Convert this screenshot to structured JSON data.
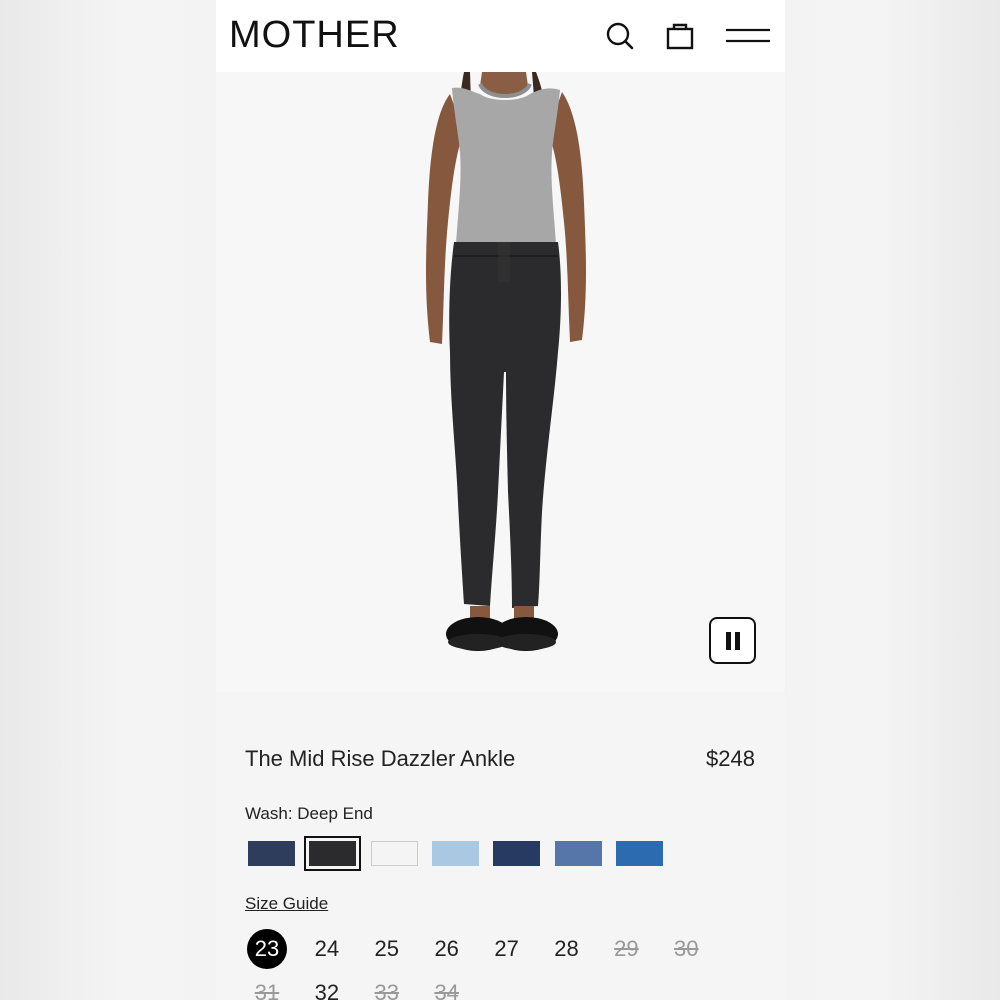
{
  "header": {
    "logo": "MOTHER",
    "icons": [
      "search-icon",
      "shopping-bag-icon",
      "hamburger-menu-icon"
    ]
  },
  "hero": {
    "media_control_icon": "pause-icon"
  },
  "product": {
    "title": "The Mid Rise Dazzler Ankle",
    "price": "$248",
    "wash_label": "Wash: Deep End",
    "swatches": [
      {
        "color": "#2f3d5c",
        "selected": false
      },
      {
        "color": "#2b2b2d",
        "selected": true
      },
      {
        "color": "#f4f4f4",
        "selected": false
      },
      {
        "color": "#aac8e2",
        "selected": false
      },
      {
        "color": "#263a62",
        "selected": false
      },
      {
        "color": "#5675a8",
        "selected": false
      },
      {
        "color": "#2c6bb0",
        "selected": false
      }
    ],
    "size_guide": "Size Guide",
    "sizes": [
      {
        "label": "23",
        "status": "selected"
      },
      {
        "label": "24",
        "status": "available"
      },
      {
        "label": "25",
        "status": "available"
      },
      {
        "label": "26",
        "status": "available"
      },
      {
        "label": "27",
        "status": "available"
      },
      {
        "label": "28",
        "status": "available"
      },
      {
        "label": "29",
        "status": "sold-out"
      },
      {
        "label": "30",
        "status": "sold-out"
      },
      {
        "label": "31",
        "status": "sold-out"
      },
      {
        "label": "32",
        "status": "available"
      },
      {
        "label": "33",
        "status": "sold-out"
      },
      {
        "label": "34",
        "status": "sold-out"
      }
    ]
  }
}
